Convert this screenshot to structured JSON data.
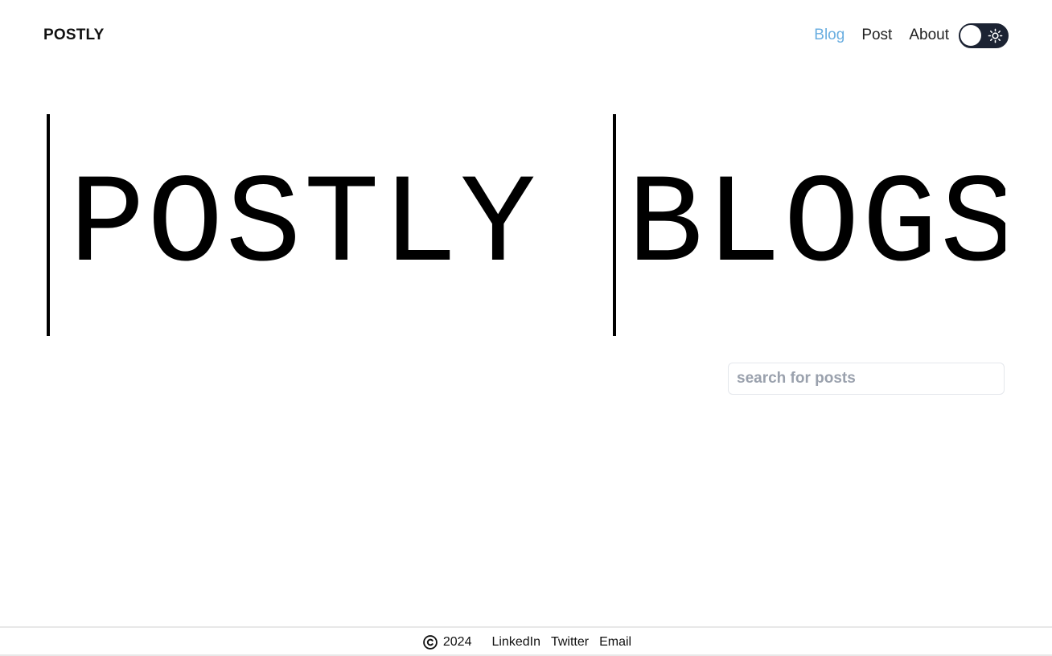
{
  "header": {
    "brand": "POSTLY",
    "nav": [
      {
        "label": "Blog",
        "active": true
      },
      {
        "label": "Post",
        "active": false
      },
      {
        "label": "About",
        "active": false
      }
    ],
    "theme_toggle": {
      "state": "light",
      "icon": "sun-icon"
    }
  },
  "hero": {
    "words": [
      "POSTLY",
      "BLOGS"
    ]
  },
  "search": {
    "placeholder": "search for posts",
    "value": ""
  },
  "footer": {
    "copyright_icon": "copyright-icon",
    "year": "2024",
    "links": [
      "LinkedIn",
      "Twitter",
      "Email"
    ]
  },
  "colors": {
    "accent": "#6aaee0",
    "toggle_bg": "#1c2333",
    "text": "#111111",
    "placeholder": "#9aa1ad",
    "border": "#e4e7ec"
  }
}
